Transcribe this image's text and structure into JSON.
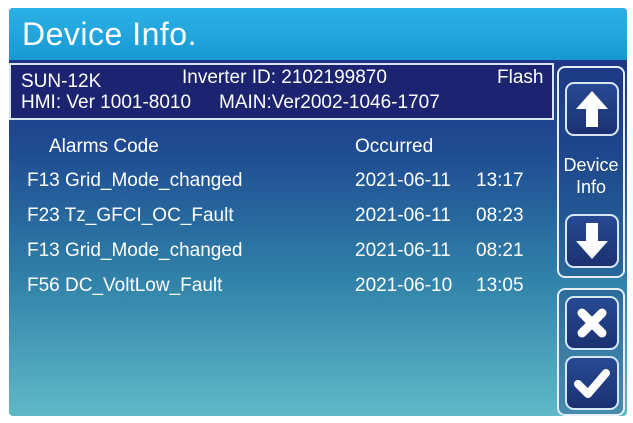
{
  "header": {
    "title": "Device Info."
  },
  "device": {
    "model": "SUN-12K",
    "inverter_id_text": "Inverter ID: 2102199870",
    "flash_label": "Flash",
    "hmi_text": "HMI: Ver 1001-8010",
    "main_text": "MAIN:Ver2002-1046-1707"
  },
  "alarms": {
    "columns": [
      "Alarms Code",
      "Occurred"
    ],
    "rows": [
      {
        "code": "F13 Grid_Mode_changed",
        "date": "2021-06-11",
        "time": "13:17"
      },
      {
        "code": "F23 Tz_GFCI_OC_Fault",
        "date": "2021-06-11",
        "time": "08:23"
      },
      {
        "code": "F13 Grid_Mode_changed",
        "date": "2021-06-11",
        "time": "08:21"
      },
      {
        "code": "F56 DC_VoltLow_Fault",
        "date": "2021-06-10",
        "time": "13:05"
      }
    ]
  },
  "sidebar": {
    "device_info_line1": "Device",
    "device_info_line2": "Info",
    "up_icon": "arrow-up-icon",
    "down_icon": "arrow-down-icon",
    "close_icon": "close-icon",
    "confirm_icon": "checkmark-icon"
  },
  "colors": {
    "title_bar": "#1799d3",
    "background_top": "#1d2a7e",
    "background_bottom": "#5fb9c7",
    "text": "#ffffff"
  }
}
